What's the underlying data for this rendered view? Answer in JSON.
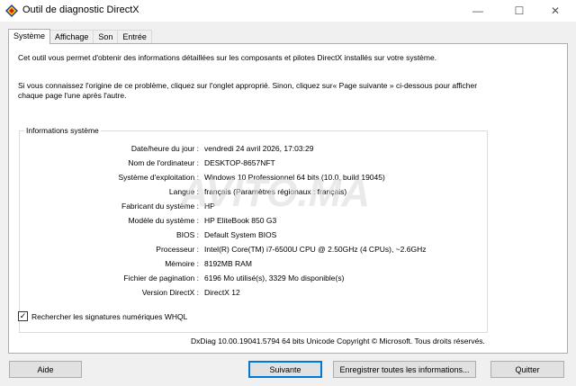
{
  "window": {
    "title": "Outil de diagnostic DirectX",
    "controls": {
      "minimize": "—",
      "maximize": "☐",
      "close": "✕"
    }
  },
  "tabs": [
    {
      "label": "Système",
      "active": true
    },
    {
      "label": "Affichage",
      "active": false
    },
    {
      "label": "Son",
      "active": false
    },
    {
      "label": "Entrée",
      "active": false
    }
  ],
  "intro": {
    "line1": "Cet outil vous permet d'obtenir des informations détaillées sur les composants et pilotes DirectX installés sur votre système.",
    "line2": "Si vous connaissez l'origine de ce problème, cliquez sur l'onglet approprié. Sinon, cliquez sur« Page suivante » ci-dessous pour afficher chaque page l'une après l'autre."
  },
  "system_info": {
    "legend": "Informations système",
    "rows": [
      {
        "label": "Date/heure du jour :",
        "value": "vendredi 24 avril 2026, 17:03:29"
      },
      {
        "label": "Nom de l'ordinateur :",
        "value": "DESKTOP-8657NFT"
      },
      {
        "label": "Système d'exploitation :",
        "value": "Windows 10 Professionnel 64 bits (10.0, build 19045)"
      },
      {
        "label": "Langue :",
        "value": "français (Paramètres régionaux : français)"
      },
      {
        "label": "Fabricant du système :",
        "value": "HP"
      },
      {
        "label": "Modèle du système :",
        "value": "HP EliteBook 850 G3"
      },
      {
        "label": "BIOS :",
        "value": "Default System BIOS"
      },
      {
        "label": "Processeur :",
        "value": "Intel(R) Core(TM) i7-6500U CPU @ 2.50GHz (4 CPUs), ~2.6GHz"
      },
      {
        "label": "Mémoire :",
        "value": "8192MB RAM"
      },
      {
        "label": "Fichier de pagination :",
        "value": "6196 Mo utilisé(s), 3329 Mo disponible(s)"
      },
      {
        "label": "Version DirectX :",
        "value": "DirectX 12"
      }
    ]
  },
  "whql": {
    "label": "Rechercher les signatures numériques WHQL",
    "checked": true,
    "checkmark": "✓"
  },
  "copyright": "DxDiag 10.00.19041.5794 64 bits Unicode Copyright © Microsoft. Tous droits réservés.",
  "buttons": {
    "help": "Aide",
    "next": "Suivante",
    "save_all": "Enregistrer toutes les informations...",
    "quit": "Quitter"
  },
  "watermark": "AVITO.MA",
  "colors": {
    "accent": "#0078d7",
    "panel_bg": "#ffffff",
    "window_bg": "#f0f0f0"
  }
}
